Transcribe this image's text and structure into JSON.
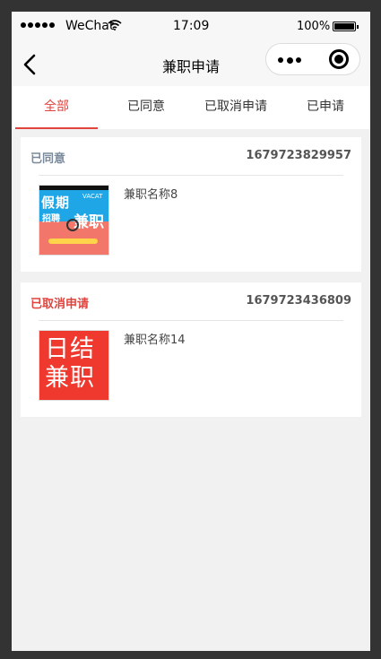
{
  "status_bar": {
    "carrier": "WeChat",
    "time": "17:09",
    "battery": "100%"
  },
  "nav": {
    "title": "兼职申请"
  },
  "tabs": [
    {
      "label": "全部",
      "active": true
    },
    {
      "label": "已同意",
      "active": false
    },
    {
      "label": "已取消申请",
      "active": false
    },
    {
      "label": "已申请",
      "active": false
    }
  ],
  "applications": [
    {
      "status": "已同意",
      "status_color": "#7a8a9a",
      "id": "1679723829957",
      "name": "兼职名称8",
      "thumb": {
        "type": "holiday-poster",
        "lines": [
          "假期",
          "招聘",
          "兼职",
          "VACAT"
        ]
      }
    },
    {
      "status": "已取消申请",
      "status_color": "#e0443d",
      "id": "1679723436809",
      "name": "兼职名称14",
      "thumb": {
        "type": "red-banner",
        "lines": [
          "日结",
          "兼职"
        ]
      }
    }
  ],
  "colors": {
    "accent": "#e0443d",
    "page_bg": "#f1f1f1"
  }
}
